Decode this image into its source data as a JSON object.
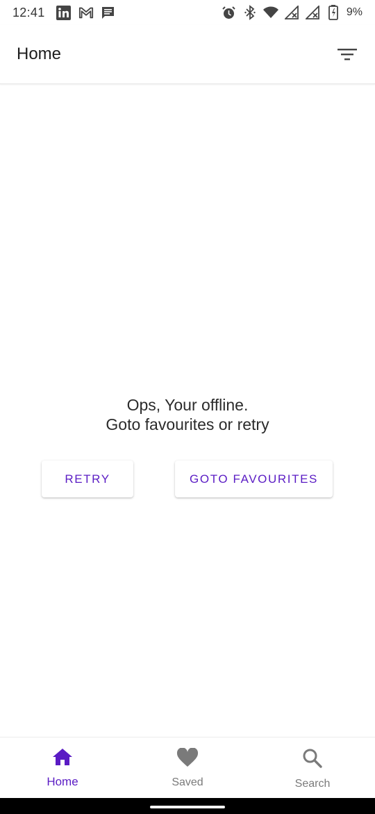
{
  "status_bar": {
    "time": "12:41",
    "battery_pct": "9%",
    "left_icons": [
      "linkedin-icon",
      "gmail-icon",
      "message-icon"
    ],
    "right_icons": [
      "alarm-icon",
      "bluetooth-icon",
      "wifi-icon",
      "signal-off-icon",
      "signal-off-icon",
      "battery-charging-icon"
    ]
  },
  "app_bar": {
    "title": "Home",
    "action_icon": "filter-icon"
  },
  "main": {
    "message_line1": "Ops, Your offline.",
    "message_line2": "Goto favourites or retry",
    "retry_label": "RETRY",
    "favourites_label": "GOTO FAVOURITES"
  },
  "bottom_nav": {
    "items": [
      {
        "label": "Home",
        "icon": "home-icon",
        "active": true
      },
      {
        "label": "Saved",
        "icon": "heart-icon",
        "active": false
      },
      {
        "label": "Search",
        "icon": "search-icon",
        "active": false
      }
    ]
  },
  "colors": {
    "accent": "#5a1bc4",
    "inactive": "#7a7a7a",
    "text": "#2b2b2b"
  }
}
